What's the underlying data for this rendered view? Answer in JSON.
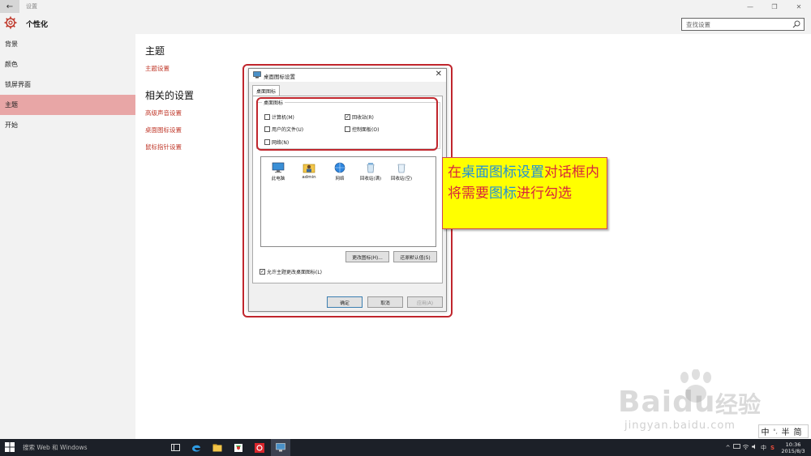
{
  "window": {
    "title": "设置",
    "back_glyph": "←",
    "min_glyph": "—",
    "max_glyph": "❐",
    "close_glyph": "✕"
  },
  "header": {
    "title": "个性化",
    "search_placeholder": "查找设置"
  },
  "sidebar": {
    "items": [
      {
        "label": "背景",
        "active": false
      },
      {
        "label": "颜色",
        "active": false
      },
      {
        "label": "锁屏界面",
        "active": false
      },
      {
        "label": "主题",
        "active": true
      },
      {
        "label": "开始",
        "active": false
      }
    ]
  },
  "main": {
    "theme_heading": "主题",
    "theme_settings_link": "主题设置",
    "related_heading": "相关的设置",
    "links": [
      "高级声音设置",
      "桌面图标设置",
      "鼠标指针设置"
    ]
  },
  "dialog": {
    "title": "桌面图标设置",
    "close_glyph": "✕",
    "tab": "桌面图标",
    "group_label": "桌面图标",
    "checkboxes": [
      {
        "label": "计算机(M)",
        "checked": false
      },
      {
        "label": "回收站(R)",
        "checked": true
      },
      {
        "label": "用户的文件(U)",
        "checked": false
      },
      {
        "label": "控制面板(O)",
        "checked": false
      },
      {
        "label": "网络(N)",
        "checked": false
      }
    ],
    "icons": [
      {
        "label": "此电脑",
        "icon": "computer-icon"
      },
      {
        "label": "admin",
        "icon": "user-folder-icon"
      },
      {
        "label": "网络",
        "icon": "network-icon"
      },
      {
        "label": "回收站(满)",
        "icon": "recycle-bin-full-icon"
      },
      {
        "label": "回收站(空)",
        "icon": "recycle-bin-empty-icon"
      }
    ],
    "change_icon_button": "更改图标(H)...",
    "restore_default_button": "还原默认值(S)",
    "allow_themes_label": "允许主题更改桌面图标(L)",
    "allow_themes_checked": true,
    "ok_button": "确定",
    "cancel_button": "取消",
    "apply_button": "应用(A)",
    "check_glyph": "✓"
  },
  "callout": {
    "segments": [
      {
        "text": "在",
        "color": "#d7263d"
      },
      {
        "text": "桌面图标设置",
        "color": "#1f8fd8"
      },
      {
        "text": "对话框内将需要",
        "color": "#d7263d"
      },
      {
        "text": "图标",
        "color": "#1f8fd8"
      },
      {
        "text": "进行勾选",
        "color": "#d7263d"
      }
    ]
  },
  "watermark": {
    "brand": "Bai",
    "brand2": "du",
    "jingyan": "经验",
    "url": "jingyan.baidu.com"
  },
  "ime": {
    "mode": "中",
    "punct": "°,",
    "width": "半",
    "script": "简"
  },
  "taskbar": {
    "search_text": "搜索 Web 和 Windows",
    "time": "10:36",
    "date": "2015/8/3",
    "tray_up": "^",
    "tray_sogou": "S",
    "tray_lang": "中"
  },
  "colors": {
    "accent": "#e8a6a6",
    "link": "#c0392b",
    "highlight_frame": "#c0262d",
    "callout_bg": "#ffff00"
  }
}
